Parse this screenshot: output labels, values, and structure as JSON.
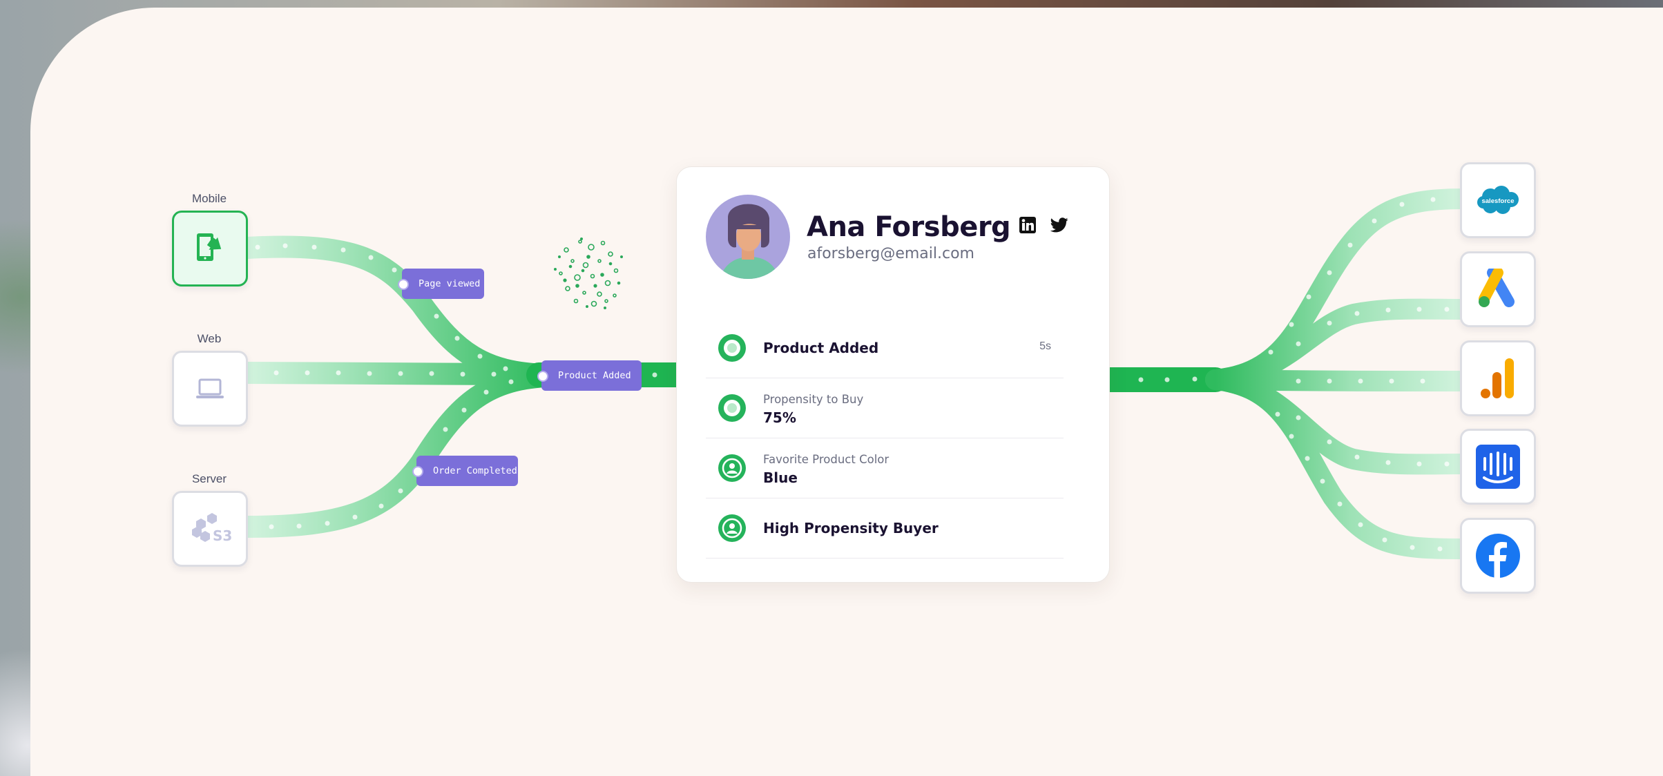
{
  "sources": [
    {
      "label": "Mobile",
      "icon": "mobile-icon"
    },
    {
      "label": "Web",
      "icon": "laptop-icon"
    },
    {
      "label": "Server",
      "icon": "aws-s3-icon"
    }
  ],
  "events": {
    "page_viewed": "Page viewed",
    "product_added": "Product Added",
    "order_completed": "Order Completed"
  },
  "profile": {
    "name": "Ana Forsberg",
    "email": "aforsberg@email.com",
    "social": [
      "linkedin-icon",
      "twitter-icon"
    ],
    "rows": [
      {
        "title": "Product Added",
        "time": "5s",
        "icon": "event-ring-icon"
      },
      {
        "label": "Propensity to Buy",
        "value": "75%",
        "icon": "event-ring-icon"
      },
      {
        "label": "Favorite Product Color",
        "value": "Blue",
        "icon": "user-trait-icon"
      },
      {
        "title": "High Propensity Buyer",
        "icon": "user-trait-icon"
      }
    ]
  },
  "destinations": [
    "salesforce-icon",
    "google-ads-icon",
    "google-analytics-icon",
    "intercom-icon",
    "facebook-icon"
  ],
  "colors": {
    "flow_green": "#1fb552",
    "flow_light": "#a8e6bf",
    "tag_purple": "#7b6fd9",
    "panel": "#fcf6f2"
  }
}
